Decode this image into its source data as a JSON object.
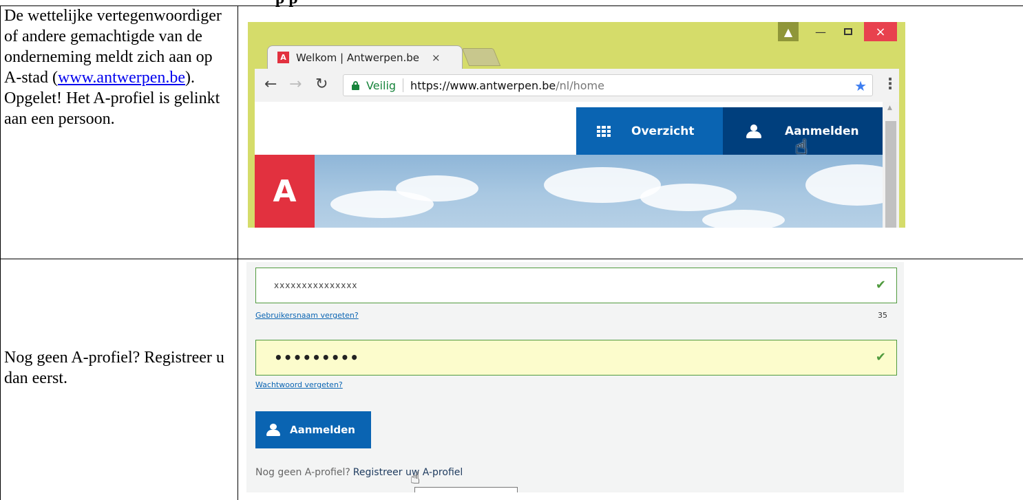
{
  "document": {
    "heading_fragment": "p                    p"
  },
  "row1": {
    "text_before_link": "De wettelijke vertegenwoordiger of andere gemachtigde van de onderneming meldt zich aan op A-stad (",
    "link_text": "www.antwerpen.be",
    "text_after_link": "). Opgelet! Het A-profiel is gelinkt aan een persoon."
  },
  "row2": {
    "text": "Nog geen A-profiel? Registreer u dan eerst."
  },
  "browser": {
    "tab_favicon": "A",
    "tab_title": "Welkom | Antwerpen.be",
    "tab_close": "×",
    "window_close": "×",
    "secure_label": "Veilig",
    "url_host": "https://www.antwerpen.be",
    "url_path": "/nl/home",
    "nav_overzicht": "Overzicht",
    "nav_aanmelden": "Aanmelden",
    "logo_text": "A",
    "icons": {
      "back": "arrow-left-icon",
      "forward": "arrow-right-icon",
      "reload": "reload-icon",
      "lock": "lock-icon",
      "star": "star-icon",
      "menu": "menu-icon",
      "grid": "grid-icon",
      "user": "user-icon"
    },
    "colors": {
      "frame": "#d5dc6a",
      "brand_red": "#e2313f",
      "nav_blue": "#0a64b2",
      "nav_dark_blue": "#003f7d",
      "secure_green": "#17843b"
    }
  },
  "login": {
    "username_value": "xxxxxxxxxxxxxxx",
    "forgot_username": "Gebruikersnaam vergeten?",
    "char_count": "35",
    "password_value": "•••••••••",
    "forgot_password": "Wachtwoord vergeten?",
    "submit_label": "Aanmelden",
    "register_prompt": "Nog geen A-profiel?",
    "register_link": "Registreer uw A-profiel",
    "colors": {
      "valid_green": "#4f9a3d",
      "button_blue": "#0a64b2",
      "password_bg": "#fcfccc"
    }
  }
}
